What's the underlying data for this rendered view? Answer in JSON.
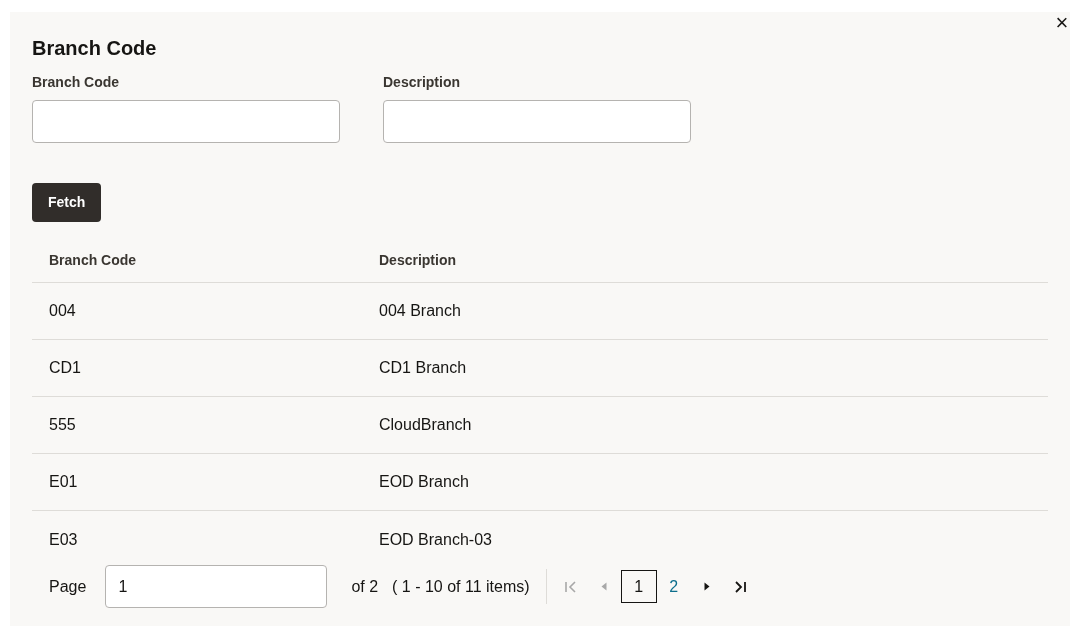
{
  "dialog": {
    "title": "Branch Code",
    "close": "×"
  },
  "filters": [
    {
      "label": "Branch Code"
    },
    {
      "label": "Description"
    }
  ],
  "fetch_button": "Fetch",
  "table": {
    "columns": [
      "Branch Code",
      "Description"
    ],
    "rows": [
      [
        "004",
        "004 Branch"
      ],
      [
        "CD1",
        "CD1 Branch"
      ],
      [
        "555",
        "CloudBranch"
      ],
      [
        "E01",
        "EOD Branch"
      ],
      [
        "E03",
        "EOD Branch-03"
      ]
    ]
  },
  "pagination": {
    "page_label": "Page",
    "page_value": "1",
    "of_pages": "of 2",
    "range": "( 1 - 10 of 11 items)",
    "nav": [
      {
        "kind": "first",
        "disabled": true
      },
      {
        "kind": "prev",
        "disabled": true
      }
    ],
    "pages": [
      {
        "label": "1",
        "selected": true
      },
      {
        "label": "2",
        "selected": false
      }
    ],
    "nav_after": [
      {
        "kind": "next",
        "disabled": false
      },
      {
        "kind": "last",
        "disabled": false
      }
    ]
  }
}
